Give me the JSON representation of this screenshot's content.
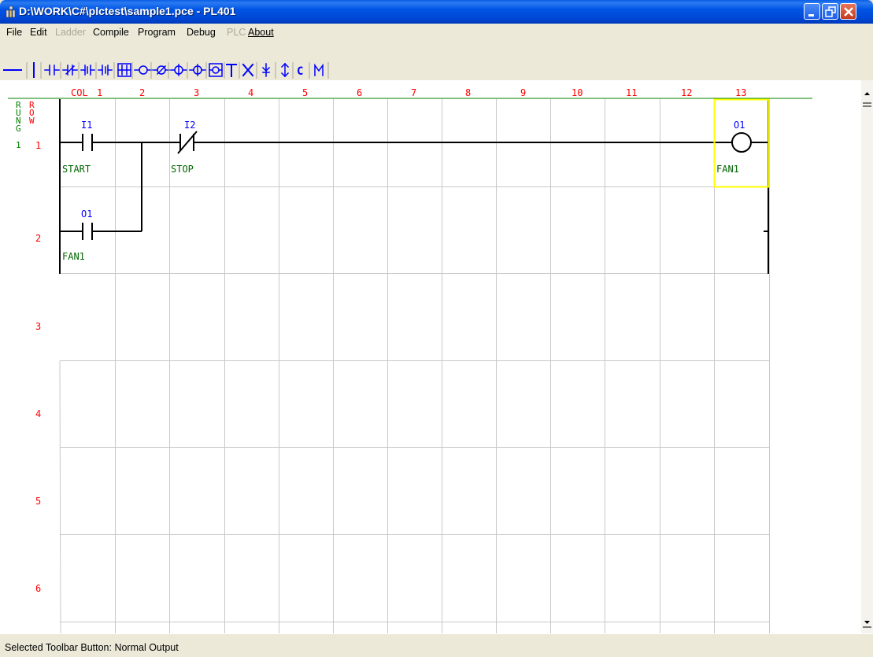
{
  "window": {
    "title": "D:\\WORK\\C#\\plctest\\sample1.pce - PL401"
  },
  "menu": {
    "file": "File",
    "edit": "Edit",
    "ladder": "Ladder",
    "compile": "Compile",
    "program": "Program",
    "debug": "Debug",
    "plc": "PLC",
    "about": "About"
  },
  "toolbar": {
    "c_label": "C",
    "m_label": "M",
    "buttons": [
      "horizontal-line",
      "vertical-line",
      "no-contact",
      "nc-contact",
      "rising-edge-contact",
      "falling-edge-contact",
      "function-block",
      "normal-output",
      "negated-output",
      "set-output",
      "reset-output",
      "special-output",
      "branch-T",
      "delete",
      "vertical-down",
      "vertical-updown",
      "counter",
      "memory"
    ]
  },
  "grid": {
    "col_header": "COL",
    "columns": [
      "1",
      "2",
      "3",
      "4",
      "5",
      "6",
      "7",
      "8",
      "9",
      "10",
      "11",
      "12",
      "13"
    ],
    "rung_letters": [
      "R",
      "U",
      "N",
      "G"
    ],
    "rung_number": "1",
    "row_letters": [
      "R",
      "O",
      "W"
    ],
    "rows": [
      "1",
      "2",
      "3",
      "4",
      "5",
      "6"
    ]
  },
  "ladder": {
    "contact1": {
      "address": "I1",
      "label": "START"
    },
    "contact2": {
      "address": "I2",
      "label": "STOP"
    },
    "contact3": {
      "address": "O1",
      "label": "FAN1"
    },
    "coil1": {
      "address": "O1",
      "label": "FAN1"
    }
  },
  "status": {
    "text": "Selected Toolbar Button: Normal Output"
  },
  "colors": {
    "title_blue": "#0055e5",
    "header_red": "#ff0000",
    "rung_green": "#008000",
    "address_blue": "#0000ff",
    "label_green": "#006400",
    "selection_yellow": "#ffff00",
    "grid": "#c8c8c8"
  }
}
